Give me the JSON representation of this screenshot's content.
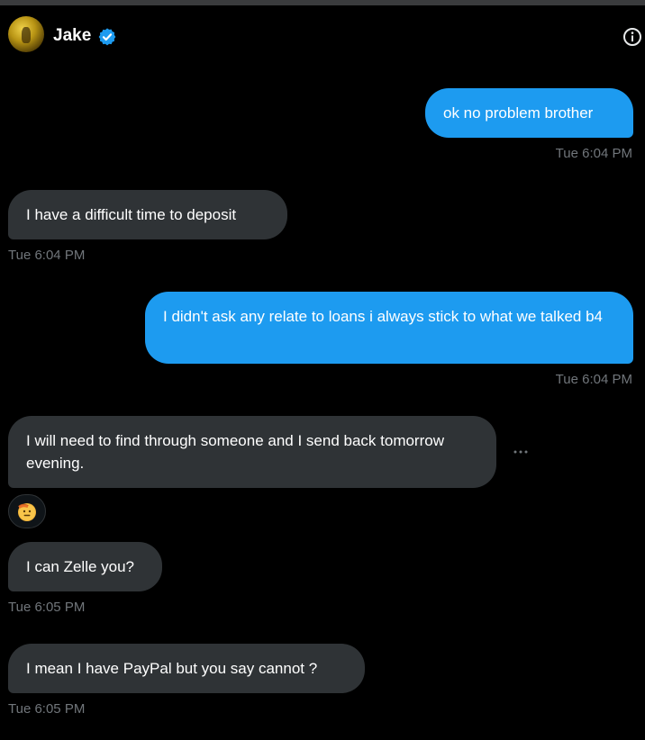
{
  "header": {
    "contact_name": "Jake",
    "verified": true,
    "accent_color": "#1d9bf0"
  },
  "messages": [
    {
      "direction": "sent",
      "text": "ok no problem brother",
      "time": "Tue 6:04 PM"
    },
    {
      "direction": "received",
      "text": "I have a difficult time to deposit",
      "time": "Tue 6:04 PM"
    },
    {
      "direction": "sent",
      "text": "I didn't ask any relate to loans i always stick to what we talked b4",
      "time": "Tue 6:04 PM"
    },
    {
      "direction": "received",
      "text": "I will need to find through someone and I send back tomorrow evening.",
      "reaction": "saluting-face-emoji"
    },
    {
      "direction": "received",
      "text": "I can Zelle you?",
      "time": "Tue 6:05 PM"
    },
    {
      "direction": "received",
      "text": "I mean I have PayPal but you say cannot ?",
      "time": "Tue 6:05 PM"
    }
  ],
  "colors": {
    "background": "#000000",
    "sent_bubble": "#1d9bf0",
    "received_bubble": "#2f3336",
    "timestamp": "#71767b"
  }
}
